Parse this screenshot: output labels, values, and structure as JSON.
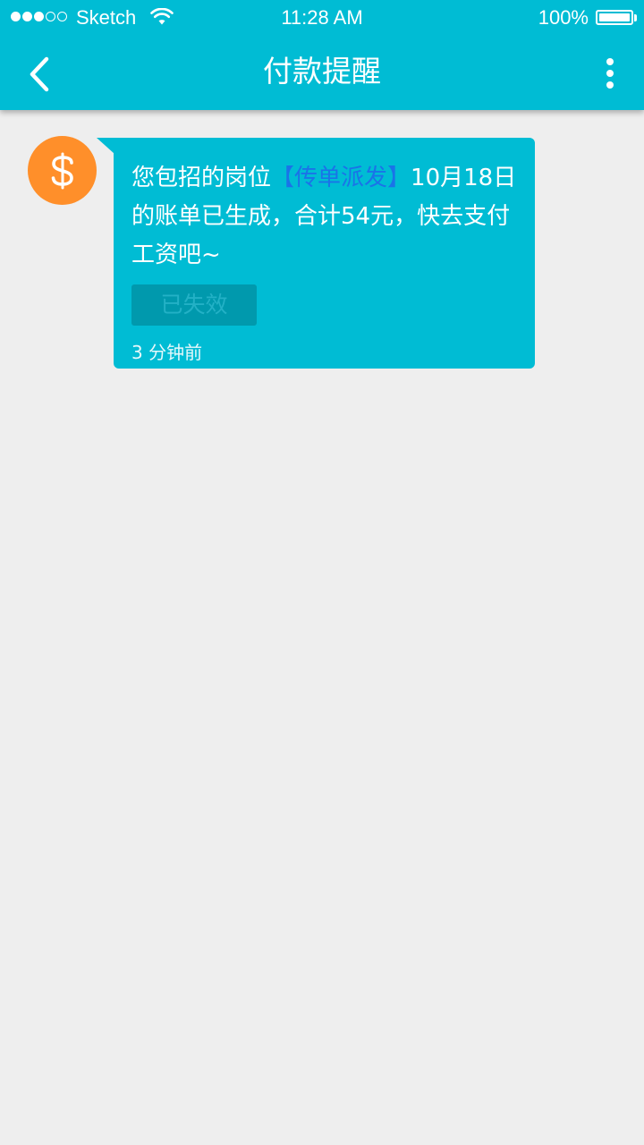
{
  "status_bar": {
    "carrier": "Sketch",
    "time": "11:28 AM",
    "battery": "100%"
  },
  "header": {
    "title": "付款提醒"
  },
  "message": {
    "text_before": "您包招的岗位",
    "job_title": "【传单派发】",
    "text_after": "10月18日的账单已生成，合计54元，快去支付工资吧~",
    "status_label": "已失效",
    "time_ago": "3 分钟前"
  },
  "icons": {
    "back": "chevron-left-icon",
    "more": "more-vertical-icon",
    "avatar": "dollar-icon",
    "wifi": "wifi-icon",
    "battery": "battery-icon"
  },
  "colors": {
    "primary": "#00bcd4",
    "avatar_bg": "#ff8f2a",
    "highlight": "#1a73e8",
    "status_button_bg": "#0099ad",
    "background": "#eeeeee"
  }
}
